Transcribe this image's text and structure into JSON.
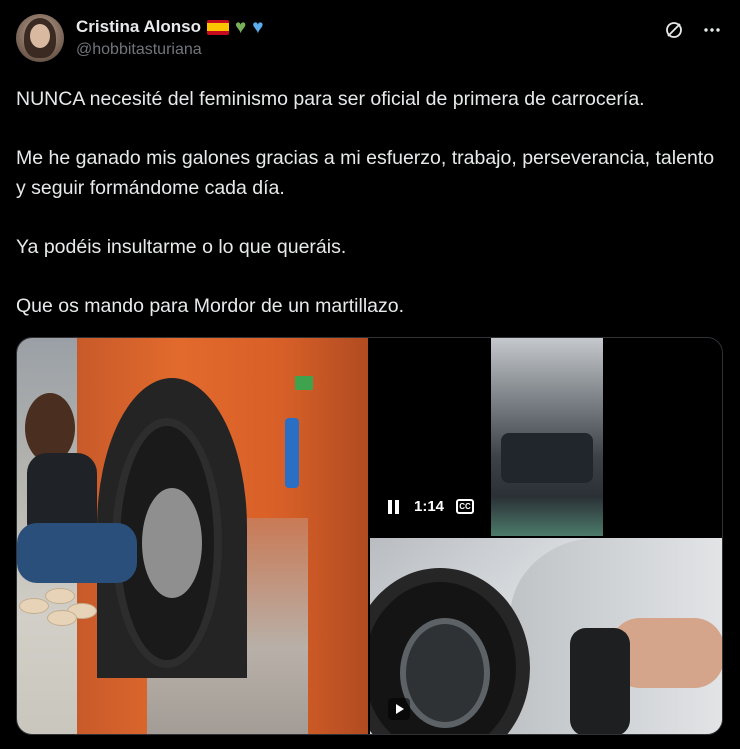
{
  "author": {
    "display_name": "Cristina Alonso",
    "handle": "@hobbitasturiana",
    "badges": [
      "spain-flag-icon",
      "green-heart-icon",
      "blue-heart-icon"
    ]
  },
  "tweet": {
    "paragraphs": [
      "NUNCA necesité del feminismo para ser oficial de primera de carrocería.",
      "Me he ganado mis galones gracias a mi esfuerzo, trabajo, perseverancia, talento y seguir formándome cada día.",
      "Ya podéis insultarme o lo que queráis.",
      "Que os mando para Mordor de un martillazo."
    ]
  },
  "media": {
    "video_time": "1:14",
    "captions_label": "CC"
  },
  "icons": {
    "grok": "grok-icon",
    "more": "more-options-icon",
    "pause": "pause-icon",
    "captions": "captions-icon",
    "play": "play-icon"
  },
  "colors": {
    "background": "#000000",
    "text": "#e7e9ea",
    "secondary": "#71767b",
    "border": "#2f3336"
  }
}
